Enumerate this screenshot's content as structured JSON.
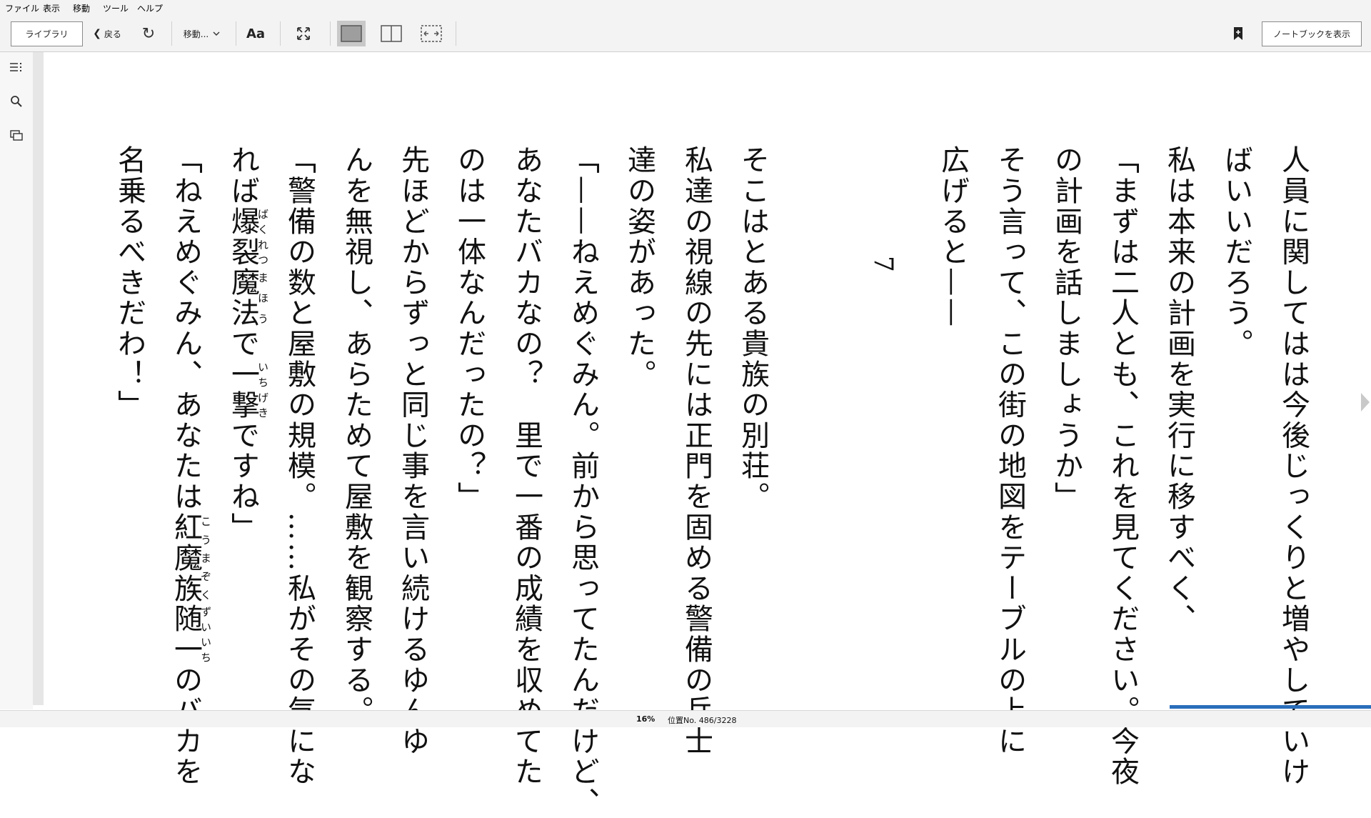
{
  "menubar": {
    "items": [
      {
        "label": "ファイル"
      },
      {
        "label": "表示"
      },
      {
        "label": "移動"
      },
      {
        "label": "ツール"
      },
      {
        "label": "ヘルプ"
      }
    ]
  },
  "toolbar": {
    "library_label": "ライブラリ",
    "back_label": "戻る",
    "goto_label": "移動...",
    "font_label": "Aa",
    "notebook_label": "ノートブックを表示"
  },
  "reader": {
    "section_number": "7",
    "lines": [
      {
        "text": "人員に関してはは今後じっくりと増やしていけ"
      },
      {
        "text": "ばいいだろう。"
      },
      {
        "text": "私は本来の計画を実行に移すべく、"
      },
      {
        "text": "「まずは二人とも、これを見てください。今夜"
      },
      {
        "text": "の計画を話しましょうか」"
      },
      {
        "text": "そう言って、この街の地図をテーブルの上に"
      },
      {
        "text": "広げると——"
      },
      {
        "text": "そこはとある貴族の別荘。"
      },
      {
        "text": "私達の視線の先には正門を固める警備の兵士"
      },
      {
        "text": "達の姿があった。"
      },
      {
        "text": "「——ねえめぐみん。前から思ってたんだけど、"
      },
      {
        "text": "あなたバカなの？　里で一番の成績を収めてた"
      },
      {
        "text": "のは一体なんだったの？」"
      },
      {
        "text": "先ほどからずっと同じ事を言い続けるゆんゆ"
      },
      {
        "text": "んを無視し、あらためて屋敷を観察する。"
      },
      {
        "text": "「警備の数と屋敷の規模。……私がその気にな"
      },
      {
        "base1": "れば",
        "ruby1_base": "爆裂",
        "ruby1": "ばくれつ",
        "ruby2_base": "魔法",
        "ruby2": "まほう",
        "mid": "で",
        "ruby3_base": "一撃",
        "ruby3": "いちげき",
        "tail": "ですね」"
      },
      {
        "head": "「ねえめぐみん、あなたは",
        "ruby1_base": "紅魔族",
        "ruby1": "こうまぞく",
        "ruby2_base": "随一",
        "ruby2": "ずいいち",
        "tail": "のバカを"
      },
      {
        "text": "名乗るべきだわ！」"
      }
    ]
  },
  "status": {
    "percent": "16%",
    "location": "位置No. 486/3228"
  },
  "progress_fraction": 0.16
}
